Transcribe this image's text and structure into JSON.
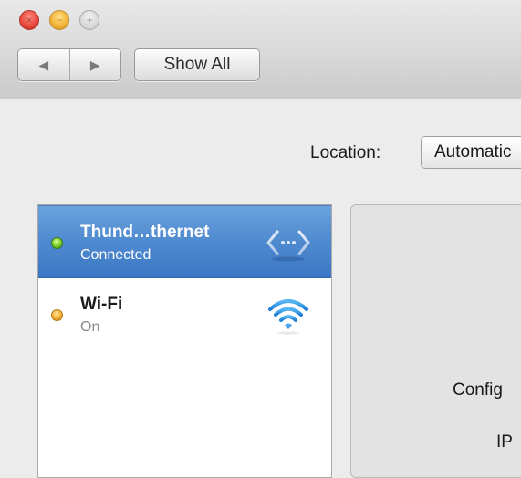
{
  "window": {
    "buttons": {
      "close_glyph": "×",
      "minimize_glyph": "−",
      "zoom_glyph": "+"
    }
  },
  "toolbar": {
    "back_glyph": "◀",
    "forward_glyph": "▶",
    "show_all_label": "Show All"
  },
  "location": {
    "label": "Location:",
    "value": "Automatic"
  },
  "services": [
    {
      "name": "Thund…thernet",
      "status": "Connected",
      "status_color": "#6cc420",
      "icon": "ethernet-arrows-icon",
      "selected": true
    },
    {
      "name": "Wi-Fi",
      "status": "On",
      "status_color": "#f0a92c",
      "icon": "wifi-icon",
      "selected": false
    }
  ],
  "detail": {
    "configure_label": "Config",
    "ip_label": "IP"
  },
  "colors": {
    "selection": "#4f8ad0",
    "window_bg": "#ececec"
  }
}
